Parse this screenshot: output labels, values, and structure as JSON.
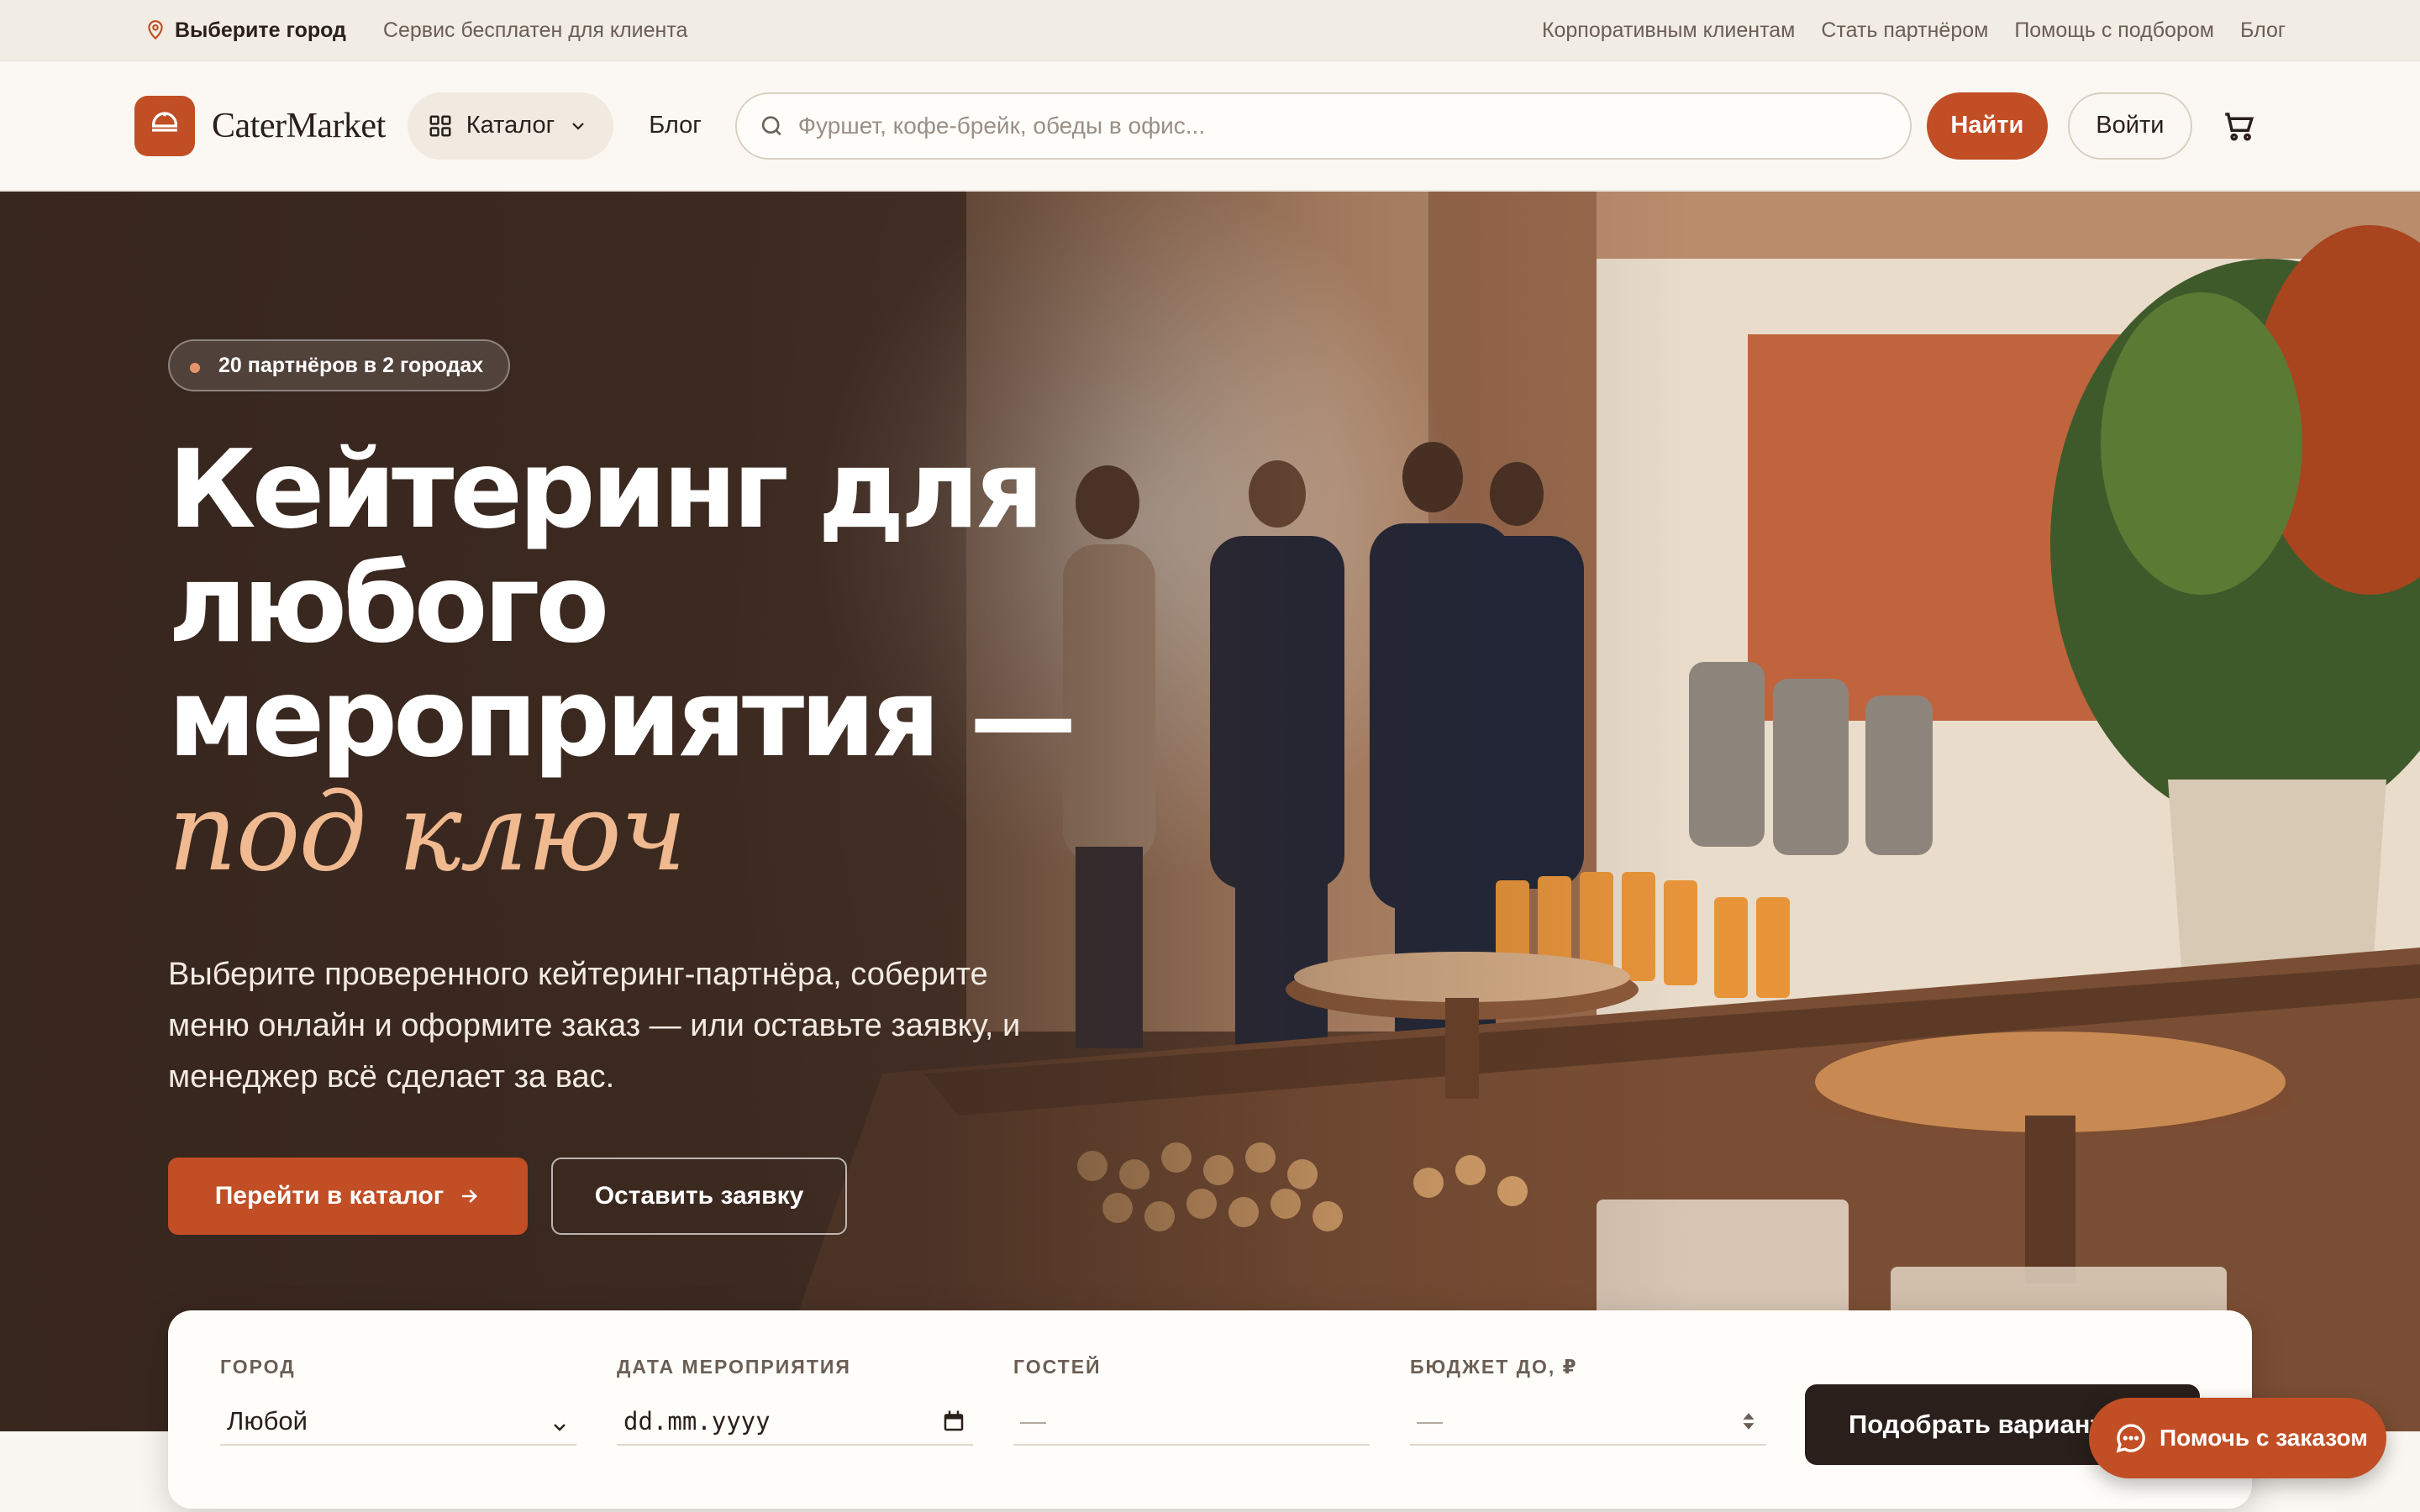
{
  "topbar": {
    "city_label": "Выберите город",
    "note": "Сервис бесплатен для клиента",
    "links": [
      "Корпоративным клиентам",
      "Стать партнёром",
      "Помощь с подбором",
      "Блог"
    ]
  },
  "header": {
    "brand": "CaterMarket",
    "catalog_label": "Каталог",
    "blog_label": "Блог",
    "search_placeholder": "Фуршет, кофе-брейк, обеды в офис...",
    "find_label": "Найти",
    "login_label": "Войти"
  },
  "hero": {
    "badge": "20 партнёров в 2 городах",
    "title_main": "Кейтеринг для любого мероприятия — ",
    "title_accent": "под ключ",
    "lead": "Выберите проверенного кейтеринг-партнёра, соберите меню онлайн и оформите заказ — или оставьте заявку, и менеджер всё сделает за вас.",
    "cta_primary": "Перейти в каталог",
    "cta_secondary": "Оставить заявку"
  },
  "filter": {
    "city_label": "ГОРОД",
    "city_value": "Любой",
    "date_label": "ДАТА МЕРОПРИЯТИЯ",
    "date_value": "dd.mm.yyyy",
    "guests_label": "ГОСТЕЙ",
    "guests_placeholder": "—",
    "budget_label": "БЮДЖЕТ ДО, ₽",
    "budget_placeholder": "—",
    "submit_label": "Подобрать варианты"
  },
  "help_button": {
    "label": "Помочь с заказом"
  },
  "colors": {
    "accent": "#c14e25",
    "dark": "#2a1f1a",
    "cream": "#faf7f2"
  }
}
